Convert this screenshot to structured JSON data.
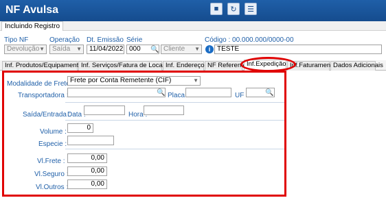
{
  "window": {
    "title": "NF Avulsa"
  },
  "toolbar": {
    "icons": [
      "save-icon",
      "refresh-icon",
      "list-icon"
    ]
  },
  "top_tab": "Incluindo Registro",
  "header": {
    "tipo_nf_label": "Tipo NF",
    "tipo_nf_value": "Devolução",
    "operacao_label": "Operação",
    "operacao_value": "Saída",
    "emissao_label": "Dt. Emissão",
    "emissao_value": "11/04/2022",
    "serie_label": "Série",
    "serie_value": "000",
    "cliente_value": "Cliente",
    "codigo_label": "Código : 00.000.000/0000-00",
    "codigo_value": "TESTE"
  },
  "tabs": [
    "Inf. Produtos/Equipamentos",
    "Inf. Serviços/Fatura de Locação",
    "Inf. Endereços",
    "NF Referente",
    "Inf.Expedição",
    "Inf.Faturamento",
    "Dados Adicionais"
  ],
  "active_tab": "Inf.Expedição",
  "form": {
    "modalidade_label": "Modalidade de Frete :",
    "modalidade_value": "Frete por Conta Remetente (CIF)",
    "transportadora_label": "Transportadora :",
    "transportadora_value": "",
    "placa_label": "Placa :",
    "placa_value": "",
    "uf_label": "UF :",
    "uf_value": "",
    "saida_label": "Saída/Entrada :",
    "data_label": "Data :",
    "data_value": "",
    "hora_label": "Hora :",
    "hora_value": "",
    "volume_label": "Volume :",
    "volume_value": "0",
    "especie_label": "Especie :",
    "especie_value": "",
    "vlfrete_label": "Vl.Frete :",
    "vlfrete_value": "0,00",
    "vlseguro_label": "Vl.Seguro :",
    "vlseguro_value": "0,00",
    "vloutros_label": "Vl.Outros :",
    "vloutros_value": "0,00"
  },
  "colors": {
    "titlebar": "#1f5fa8",
    "label": "#1f5fa8",
    "highlight": "#e00000"
  }
}
